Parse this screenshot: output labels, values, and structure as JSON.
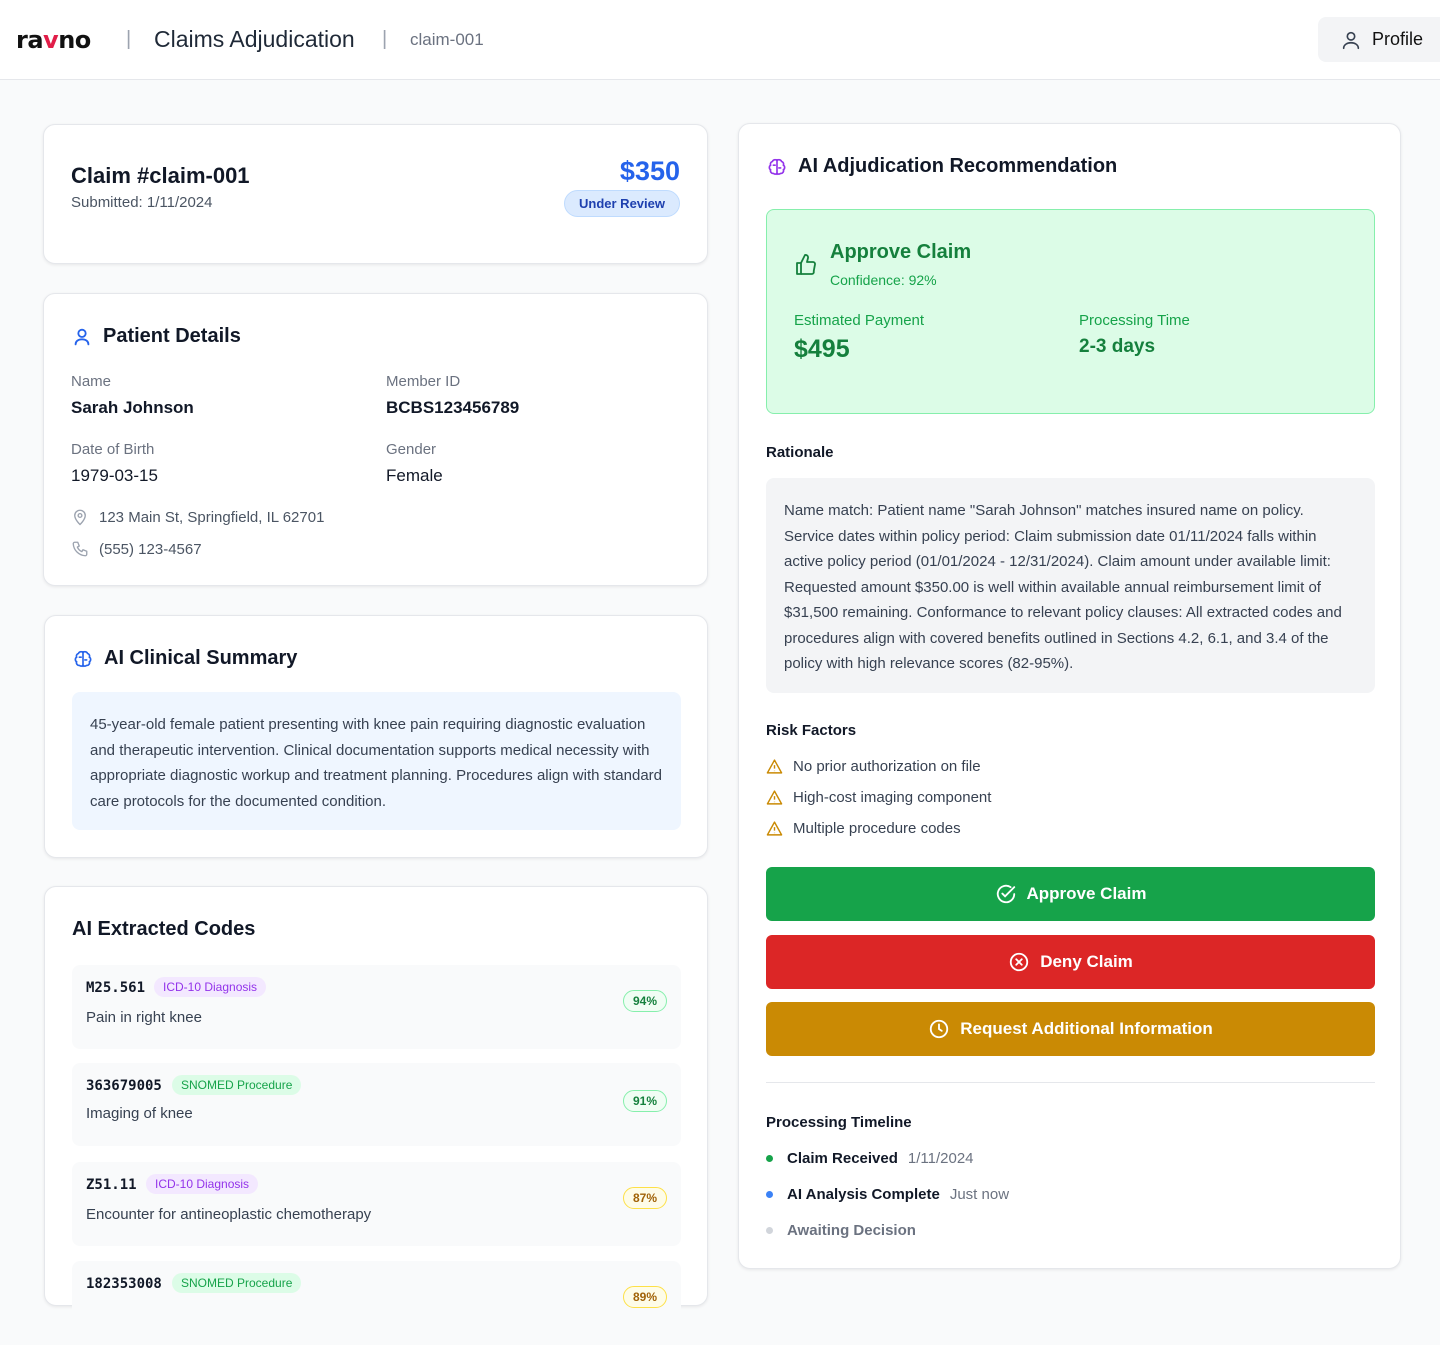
{
  "header": {
    "logo_left": "ra",
    "logo_v": "v",
    "logo_right": "no",
    "separator": "|",
    "app_title": "Claims Adjudication",
    "claim_crumb": "claim-001",
    "profile_label": "Profile"
  },
  "claim": {
    "title": "Claim #claim-001",
    "submitted": "Submitted: 1/11/2024",
    "amount": "$350",
    "status": "Under Review"
  },
  "patient": {
    "section_title": "Patient Details",
    "name_label": "Name",
    "name": "Sarah Johnson",
    "member_id_label": "Member ID",
    "member_id": "BCBS123456789",
    "dob_label": "Date of Birth",
    "dob": "1979-03-15",
    "gender_label": "Gender",
    "gender": "Female",
    "address": "123 Main St, Springfield, IL 62701",
    "phone": "(555) 123-4567"
  },
  "clinical_summary": {
    "section_title": "AI Clinical Summary",
    "text": "45-year-old female patient presenting with knee pain requiring diagnostic evaluation and therapeutic intervention. Clinical documentation supports medical necessity with appropriate diagnostic workup and treatment planning. Procedures align with standard care protocols for the documented condition."
  },
  "codes": {
    "section_title": "AI Extracted Codes",
    "items": [
      {
        "code": "M25.561",
        "type": "ICD-10 Diagnosis",
        "description": "Pain in right knee",
        "confidence": "94%"
      },
      {
        "code": "363679005",
        "type": "SNOMED Procedure",
        "description": "Imaging of knee",
        "confidence": "91%"
      },
      {
        "code": "Z51.11",
        "type": "ICD-10 Diagnosis",
        "description": "Encounter for antineoplastic chemotherapy",
        "confidence": "87%"
      },
      {
        "code": "182353008",
        "type": "SNOMED Procedure",
        "description": "",
        "confidence": "89%"
      }
    ]
  },
  "recommendation": {
    "section_title": "AI Adjudication Recommendation",
    "decision": "Approve Claim",
    "confidence": "Confidence: 92%",
    "payment_label": "Estimated Payment",
    "payment": "$495",
    "time_label": "Processing Time",
    "time": "2-3 days",
    "rationale_label": "Rationale",
    "rationale": "Name match: Patient name \"Sarah Johnson\" matches insured name on policy. Service dates within policy period: Claim submission date 01/11/2024 falls within active policy period (01/01/2024 - 12/31/2024). Claim amount under available limit: Requested amount $350.00 is well within available annual reimbursement limit of $31,500 remaining. Conformance to relevant policy clauses: All extracted codes and procedures align with covered benefits outlined in Sections 4.2, 6.1, and 3.4 of the policy with high relevance scores (82-95%).",
    "risk_label": "Risk Factors",
    "risks": [
      "No prior authorization on file",
      "High-cost imaging component",
      "Multiple procedure codes"
    ]
  },
  "actions": {
    "approve": "Approve Claim",
    "deny": "Deny Claim",
    "request": "Request Additional Information"
  },
  "timeline": {
    "title": "Processing Timeline",
    "items": [
      {
        "label": "Claim Received",
        "time": "1/11/2024",
        "color": "#16a34a"
      },
      {
        "label": "AI Analysis Complete",
        "time": "Just now",
        "color": "#3b82f6"
      },
      {
        "label": "Awaiting Decision",
        "time": "",
        "color": "#d1d5db"
      }
    ]
  },
  "colors": {
    "brand_blue": "#2563eb",
    "approve_green": "#16a34a",
    "deny_red": "#dc2626",
    "request_amber": "#ca8a04"
  }
}
